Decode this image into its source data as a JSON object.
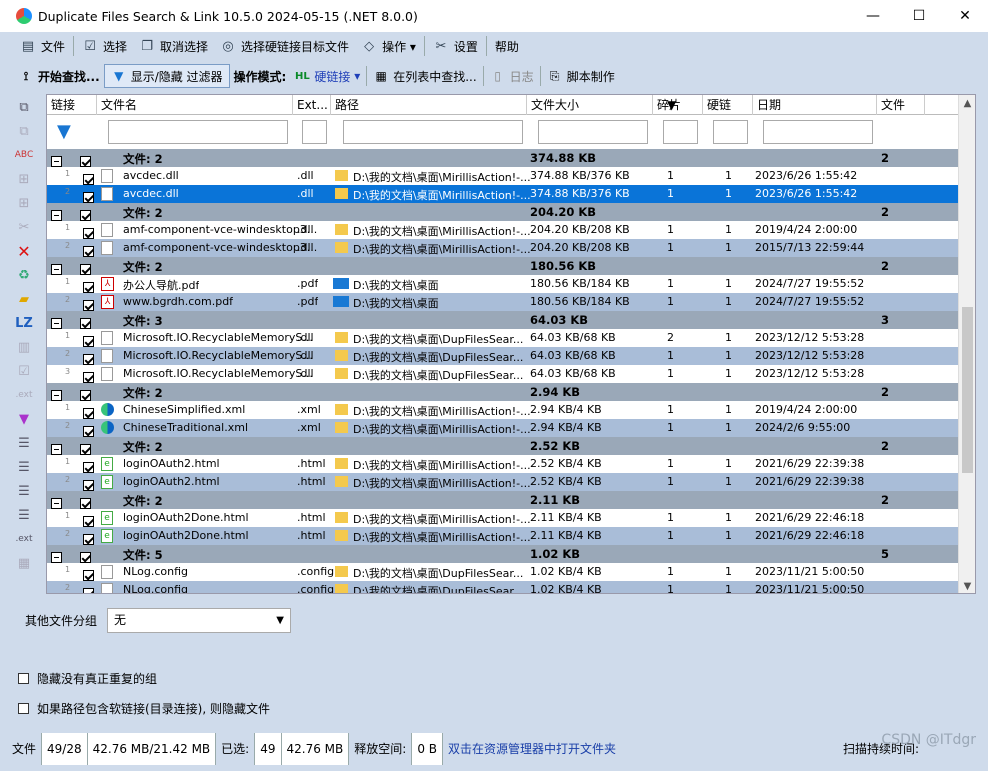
{
  "window": {
    "title": "Duplicate Files Search & Link 10.5.0 2024-05-15 (.NET 8.0.0)",
    "min_glyph": "—",
    "max_glyph": "☐",
    "close_glyph": "✕"
  },
  "menu": [
    {
      "label": "文件",
      "icon": "file-icon"
    },
    {
      "label": "选择",
      "icon": "checkbox-icon"
    },
    {
      "label": "取消选择",
      "icon": "uncheck-icon"
    },
    {
      "label": "选择硬链接目标文件",
      "icon": "link-target-icon"
    },
    {
      "label": "操作 ▾",
      "icon": "operation-icon"
    },
    {
      "label": "设置",
      "icon": "settings-icon"
    },
    {
      "label": "帮助",
      "icon": ""
    }
  ],
  "toolbar": {
    "start": "开始查找...",
    "filter": "显示/隐藏 过滤器",
    "op_mode_label": "操作模式:",
    "op_mode_value": "硬链接",
    "find_in_list": "在列表中查找...",
    "log": "日志",
    "script": "脚本制作",
    "hl_badge": "HL"
  },
  "columns": [
    "链接",
    "文件名",
    "Ext...",
    "路径",
    "文件大小",
    "碎片",
    "硬链",
    "日期",
    "文件"
  ],
  "groups": [
    {
      "label": "文件: 2",
      "size": "374.88 KB",
      "count": "2",
      "rows": [
        {
          "n": "1",
          "name": "avcdec.dll",
          "ext": ".dll",
          "path": "D:\\我的文档\\桌面\\MirillisAction!-...",
          "size": "374.88 KB/376 KB",
          "frag": "1",
          "hl": "1",
          "date": "2023/6/26 1:55:42",
          "icon": "file",
          "folder": "yellow",
          "style": "r1"
        },
        {
          "n": "2",
          "name": "avcdec.dll",
          "ext": ".dll",
          "path": "D:\\我的文档\\桌面\\MirillisAction!-...",
          "size": "374.88 KB/376 KB",
          "frag": "1",
          "hl": "1",
          "date": "2023/6/26 1:55:42",
          "icon": "file",
          "folder": "yellow",
          "style": "sel"
        }
      ]
    },
    {
      "label": "文件: 2",
      "size": "204.20 KB",
      "count": "2",
      "rows": [
        {
          "n": "1",
          "name": "amf-component-vce-windesktop3...",
          "ext": ".dll",
          "path": "D:\\我的文档\\桌面\\MirillisAction!-...",
          "size": "204.20 KB/208 KB",
          "frag": "1",
          "hl": "1",
          "date": "2019/4/24 2:00:00",
          "icon": "file",
          "folder": "yellow",
          "style": "r1"
        },
        {
          "n": "2",
          "name": "amf-component-vce-windesktop3...",
          "ext": ".dll",
          "path": "D:\\我的文档\\桌面\\MirillisAction!-...",
          "size": "204.20 KB/208 KB",
          "frag": "1",
          "hl": "1",
          "date": "2015/7/13 22:59:44",
          "icon": "file",
          "folder": "yellow",
          "style": "r2"
        }
      ]
    },
    {
      "label": "文件: 2",
      "size": "180.56 KB",
      "count": "2",
      "rows": [
        {
          "n": "1",
          "name": "办公人导航.pdf",
          "ext": ".pdf",
          "path": "D:\\我的文档\\桌面",
          "size": "180.56 KB/184 KB",
          "frag": "1",
          "hl": "1",
          "date": "2024/7/27 19:55:52",
          "icon": "pdf",
          "folder": "blue",
          "style": "r1"
        },
        {
          "n": "2",
          "name": "www.bgrdh.com.pdf",
          "ext": ".pdf",
          "path": "D:\\我的文档\\桌面",
          "size": "180.56 KB/184 KB",
          "frag": "1",
          "hl": "1",
          "date": "2024/7/27 19:55:52",
          "icon": "pdf",
          "folder": "blue",
          "style": "r2"
        }
      ]
    },
    {
      "label": "文件: 3",
      "size": "64.03 KB",
      "count": "3",
      "rows": [
        {
          "n": "1",
          "name": "Microsoft.IO.RecyclableMemoryS...",
          "ext": ".dll",
          "path": "D:\\我的文档\\桌面\\DupFilesSear...",
          "size": "64.03 KB/68 KB",
          "frag": "2",
          "hl": "1",
          "date": "2023/12/12 5:53:28",
          "icon": "file",
          "folder": "yellow",
          "style": "r1"
        },
        {
          "n": "2",
          "name": "Microsoft.IO.RecyclableMemoryS...",
          "ext": ".dll",
          "path": "D:\\我的文档\\桌面\\DupFilesSear...",
          "size": "64.03 KB/68 KB",
          "frag": "1",
          "hl": "1",
          "date": "2023/12/12 5:53:28",
          "icon": "file",
          "folder": "yellow",
          "style": "r2"
        },
        {
          "n": "3",
          "name": "Microsoft.IO.RecyclableMemoryS...",
          "ext": ".dll",
          "path": "D:\\我的文档\\桌面\\DupFilesSear...",
          "size": "64.03 KB/68 KB",
          "frag": "1",
          "hl": "1",
          "date": "2023/12/12 5:53:28",
          "icon": "file",
          "folder": "yellow",
          "style": "r1"
        }
      ]
    },
    {
      "label": "文件: 2",
      "size": "2.94 KB",
      "count": "2",
      "rows": [
        {
          "n": "1",
          "name": "ChineseSimplified.xml",
          "ext": ".xml",
          "path": "D:\\我的文档\\桌面\\MirillisAction!-...",
          "size": "2.94 KB/4 KB",
          "frag": "1",
          "hl": "1",
          "date": "2019/4/24 2:00:00",
          "icon": "edge",
          "folder": "yellow",
          "style": "r1"
        },
        {
          "n": "2",
          "name": "ChineseTraditional.xml",
          "ext": ".xml",
          "path": "D:\\我的文档\\桌面\\MirillisAction!-...",
          "size": "2.94 KB/4 KB",
          "frag": "1",
          "hl": "1",
          "date": "2024/2/6 9:55:00",
          "icon": "edge",
          "folder": "yellow",
          "style": "r2"
        }
      ]
    },
    {
      "label": "文件: 2",
      "size": "2.52 KB",
      "count": "2",
      "rows": [
        {
          "n": "1",
          "name": "loginOAuth2.html",
          "ext": ".html",
          "path": "D:\\我的文档\\桌面\\MirillisAction!-...",
          "size": "2.52 KB/4 KB",
          "frag": "1",
          "hl": "1",
          "date": "2021/6/29 22:39:38",
          "icon": "html",
          "folder": "yellow",
          "style": "r1"
        },
        {
          "n": "2",
          "name": "loginOAuth2.html",
          "ext": ".html",
          "path": "D:\\我的文档\\桌面\\MirillisAction!-...",
          "size": "2.52 KB/4 KB",
          "frag": "1",
          "hl": "1",
          "date": "2021/6/29 22:39:38",
          "icon": "html",
          "folder": "yellow",
          "style": "r2"
        }
      ]
    },
    {
      "label": "文件: 2",
      "size": "2.11 KB",
      "count": "2",
      "rows": [
        {
          "n": "1",
          "name": "loginOAuth2Done.html",
          "ext": ".html",
          "path": "D:\\我的文档\\桌面\\MirillisAction!-...",
          "size": "2.11 KB/4 KB",
          "frag": "1",
          "hl": "1",
          "date": "2021/6/29 22:46:18",
          "icon": "html",
          "folder": "yellow",
          "style": "r1"
        },
        {
          "n": "2",
          "name": "loginOAuth2Done.html",
          "ext": ".html",
          "path": "D:\\我的文档\\桌面\\MirillisAction!-...",
          "size": "2.11 KB/4 KB",
          "frag": "1",
          "hl": "1",
          "date": "2021/6/29 22:46:18",
          "icon": "html",
          "folder": "yellow",
          "style": "r2"
        }
      ]
    },
    {
      "label": "文件: 5",
      "size": "1.02 KB",
      "count": "5",
      "rows": [
        {
          "n": "1",
          "name": "NLog.config",
          "ext": ".config",
          "path": "D:\\我的文档\\桌面\\DupFilesSear...",
          "size": "1.02 KB/4 KB",
          "frag": "1",
          "hl": "1",
          "date": "2023/11/21 5:00:50",
          "icon": "file",
          "folder": "yellow",
          "style": "r1"
        },
        {
          "n": "2",
          "name": "NLog.config",
          "ext": ".config",
          "path": "D:\\我的文档\\桌面\\DupFilesSear...",
          "size": "1.02 KB/4 KB",
          "frag": "1",
          "hl": "1",
          "date": "2023/11/21 5:00:50",
          "icon": "file",
          "folder": "yellow",
          "style": "r2"
        }
      ]
    }
  ],
  "bottom": {
    "other_group_label": "其他文件分组",
    "other_group_value": "无",
    "hide_no_dup": "隐藏没有真正重复的组",
    "hide_softlink": "如果路径包含软链接(目录连接), 则隐藏文件"
  },
  "status": {
    "files_label": "文件",
    "files_value": "49/28",
    "size_value": "42.76 MB/21.42 MB",
    "selected_label": "已选:",
    "selected_count": "49",
    "selected_size": "42.76 MB",
    "free_label": "释放空间:",
    "free_value": "0 B",
    "hint": "双击在资源管理器中打开文件夹",
    "scan_time_label": "扫描持续时间:"
  },
  "watermark": "CSDN @ITdgr",
  "colors": {
    "selected_row": "#0a74d8",
    "alt_row": "#a9bdd8",
    "group_row": "#9aa8b8",
    "app_bg": "#cfdbeb"
  }
}
